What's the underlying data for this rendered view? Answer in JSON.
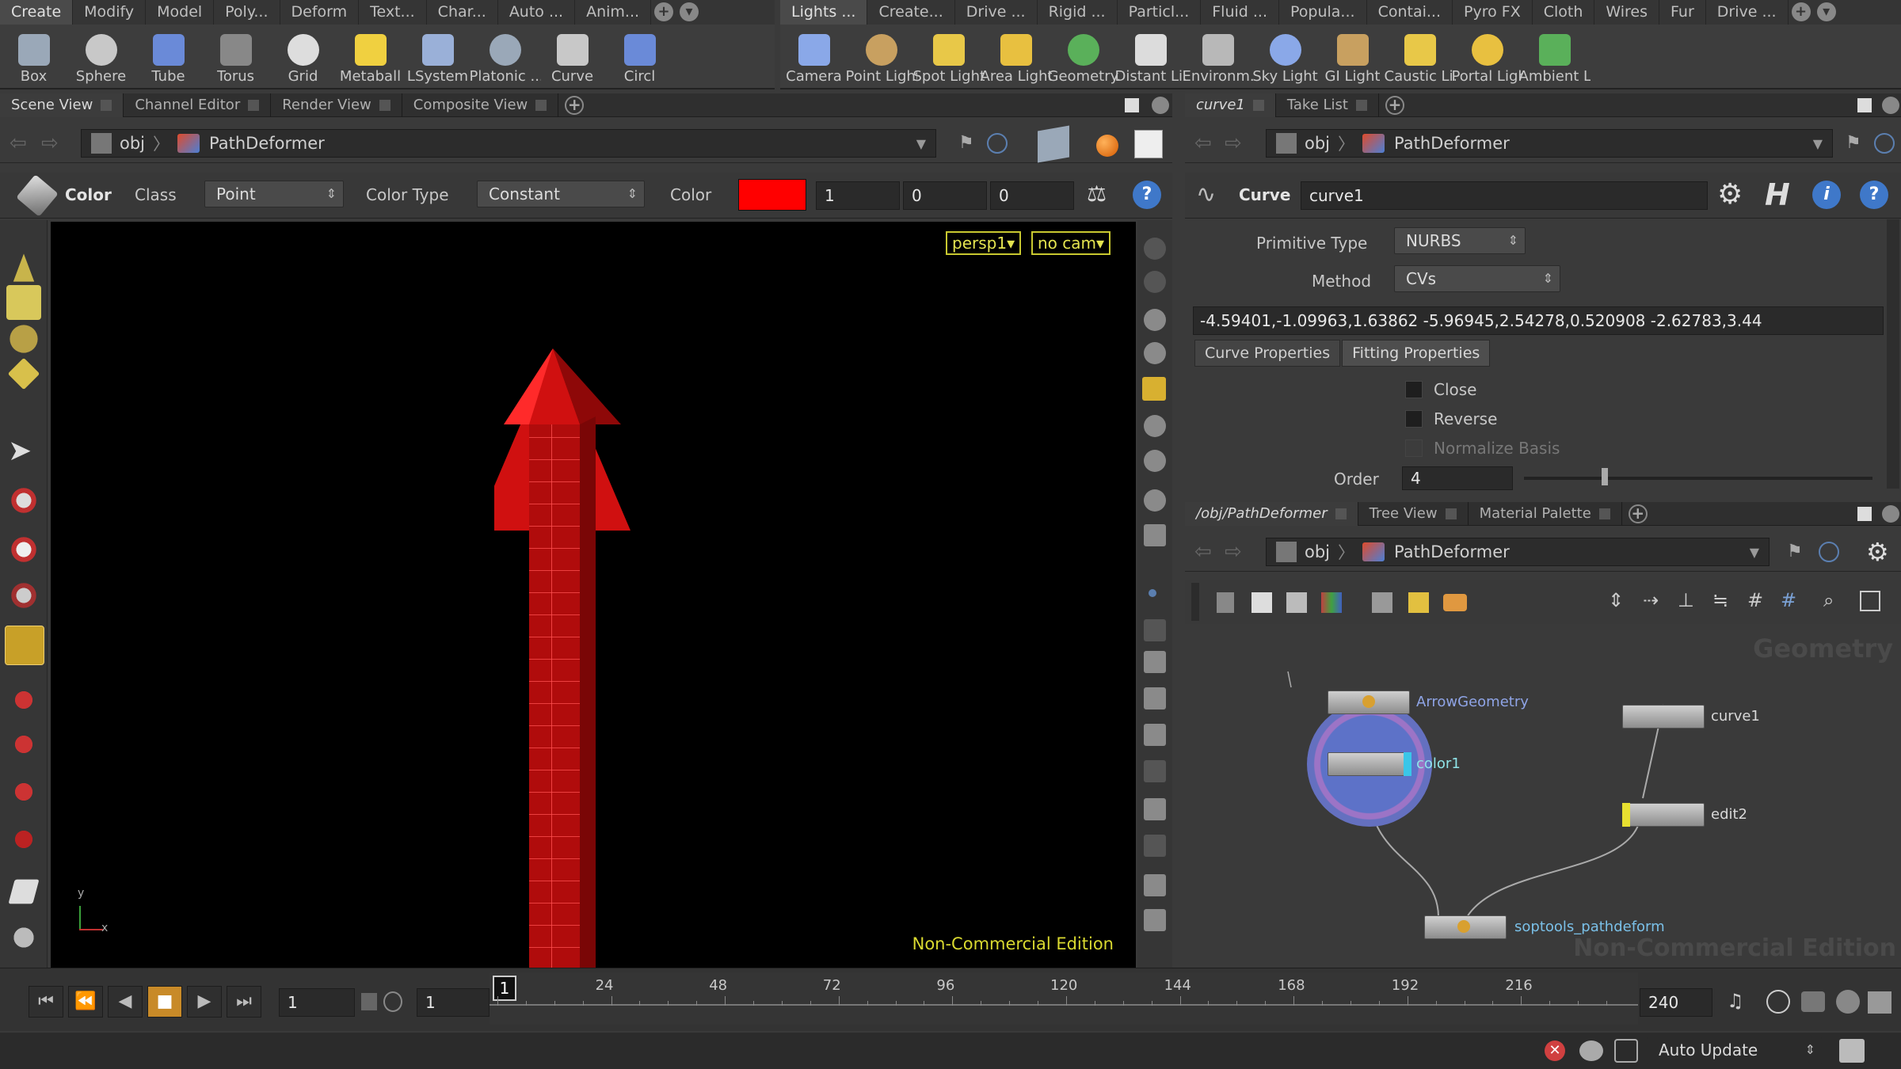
{
  "shelf_left": {
    "tabs": [
      "Create",
      "Modify",
      "Model",
      "Poly...",
      "Deform",
      "Text...",
      "Char...",
      "Auto ...",
      "Anim..."
    ],
    "tools": [
      "Box",
      "Sphere",
      "Tube",
      "Torus",
      "Grid",
      "Metaball",
      "LSystem",
      "Platonic ...",
      "Curve",
      "Circl"
    ]
  },
  "shelf_right": {
    "tabs": [
      "Lights ...",
      "Create...",
      "Drive ...",
      "Rigid ...",
      "Particl...",
      "Fluid ...",
      "Popula...",
      "Contai...",
      "Pyro FX",
      "Cloth",
      "Wires",
      "Fur",
      "Drive ..."
    ],
    "tools": [
      "Camera",
      "Point Light",
      "Spot Light",
      "Area Light",
      "Geometry...",
      "Distant Li...",
      "Environm...",
      "Sky Light",
      "GI Light",
      "Caustic Li...",
      "Portal Light",
      "Ambient L..."
    ]
  },
  "left_pane": {
    "tabs": [
      "Scene View",
      "Channel Editor",
      "Render View",
      "Composite View"
    ],
    "path": {
      "root": "obj",
      "node": "PathDeformer"
    },
    "color_node": {
      "op_label": "Color",
      "class_label": "Class",
      "class_value": "Point",
      "color_type_label": "Color Type",
      "color_type_value": "Constant",
      "color_label": "Color",
      "swatch": "#ff0000",
      "r": "1",
      "g": "0",
      "b": "0"
    },
    "viewport": {
      "camera_menu": "persp1▾",
      "cam_menu": "no cam▾",
      "watermark": "Non-Commercial Edition",
      "axis_y": "y",
      "axis_x": "x",
      "geometry_color": "#e01010"
    }
  },
  "parm_pane": {
    "tabs": [
      "curve1",
      "Take List"
    ],
    "path": {
      "root": "obj",
      "node": "PathDeformer"
    },
    "op_type": "Curve",
    "node_name": "curve1",
    "primitive_type_label": "Primitive Type",
    "primitive_type_value": "NURBS",
    "method_label": "Method",
    "method_value": "CVs",
    "coords": "-4.59401,-1.09963,1.63862 -5.96945,2.54278,0.520908 -2.62783,3.44",
    "subtabs": [
      "Curve Properties",
      "Fitting Properties"
    ],
    "close_label": "Close",
    "reverse_label": "Reverse",
    "normalize_label": "Normalize Basis",
    "order_label": "Order",
    "order_value": "4"
  },
  "network_pane": {
    "tabs": [
      "/obj/PathDeformer",
      "Tree View",
      "Material Palette"
    ],
    "path": {
      "root": "obj",
      "node": "PathDeformer"
    },
    "context_label": "Geometry",
    "watermark": "Non-Commercial Edition",
    "nodes": {
      "arrow": "ArrowGeometry",
      "color": "color1",
      "curve": "curve1",
      "edit": "edit2",
      "deform": "soptools_pathdeform"
    }
  },
  "timeline": {
    "current_frame": "1",
    "start_frame": "1",
    "frame_marker": "1",
    "end_frame": "240",
    "ticks": [
      "24",
      "48",
      "72",
      "96",
      "120",
      "144",
      "168",
      "192",
      "216"
    ]
  },
  "statusbar": {
    "update_mode": "Auto Update"
  }
}
